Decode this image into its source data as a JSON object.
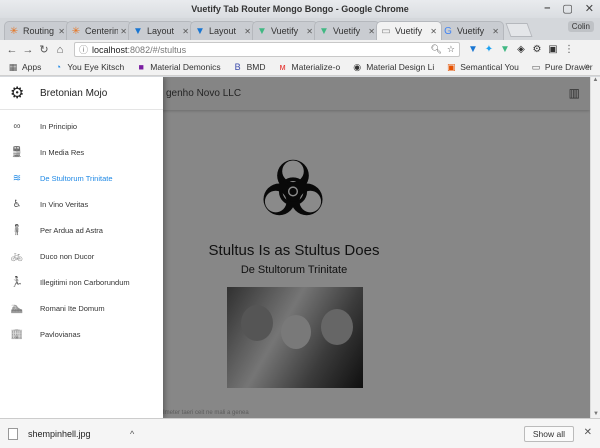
{
  "window": {
    "title": "Vuetify Tab Router Mongo Bongo - Google Chrome",
    "controls": [
      "–",
      "▢",
      "✕"
    ]
  },
  "tabs": [
    {
      "label": "Routing",
      "icon": "asterisk-icon",
      "color": "#e8711a",
      "active": false
    },
    {
      "label": "Centerin",
      "icon": "asterisk-icon",
      "color": "#e8711a",
      "active": false
    },
    {
      "label": "Layout",
      "icon": "vuetify-icon",
      "color": "#1976d2",
      "active": false
    },
    {
      "label": "Layout",
      "icon": "vuetify-icon",
      "color": "#1976d2",
      "active": false
    },
    {
      "label": "Vuetify",
      "icon": "vue-icon",
      "color": "#41b883",
      "active": false
    },
    {
      "label": "Vuetify",
      "icon": "vue-icon",
      "color": "#41b883",
      "active": false
    },
    {
      "label": "Vuetify",
      "icon": "page-icon",
      "color": "#888888",
      "active": true
    },
    {
      "label": "Vuetify",
      "icon": "google-icon",
      "color": "#4285f4",
      "active": false
    }
  ],
  "profile": "Colin",
  "toolbar": {
    "back": "←",
    "forward": "→",
    "reload": "↻",
    "home": "⌂",
    "url_host": "localhost",
    "url_rest": ":8082/#/stultus",
    "info": "ⓘ"
  },
  "bookmarks": [
    {
      "label": "Apps",
      "color": "#555555",
      "glyph": "▦"
    },
    {
      "label": "You Eye Kitsch",
      "color": "#1e88e5",
      "glyph": "◔"
    },
    {
      "label": "Material Demonics",
      "color": "#7b1fa2",
      "glyph": "■"
    },
    {
      "label": "BMD",
      "color": "#3949ab",
      "glyph": "B"
    },
    {
      "label": "Materialize-o",
      "color": "#e53935",
      "glyph": "ᴍ"
    },
    {
      "label": "Material Design Li",
      "color": "#333333",
      "glyph": "◉"
    },
    {
      "label": "Semantical You",
      "color": "#e65100",
      "glyph": "▣"
    },
    {
      "label": "Pure Drawer",
      "color": "#555555",
      "glyph": "▭"
    }
  ],
  "appbar": {
    "title": "genho Novo LLC"
  },
  "drawer": {
    "title": "Bretonian Mojo",
    "items": [
      {
        "label": "In Principio",
        "icon": "infinity-icon",
        "glyph": "∞",
        "active": false
      },
      {
        "label": "In Media Res",
        "icon": "train-icon",
        "glyph": "🚆",
        "active": false
      },
      {
        "label": "De Stultorum Trinitate",
        "icon": "waves-icon",
        "glyph": "≋",
        "active": true
      },
      {
        "label": "In Vino Veritas",
        "icon": "wheelchair-icon",
        "glyph": "♿",
        "active": false
      },
      {
        "label": "Per Ardua ad Astra",
        "icon": "person-icon",
        "glyph": "🧍",
        "active": false
      },
      {
        "label": "Duco non Ducor",
        "icon": "bicycle-icon",
        "glyph": "🚲",
        "active": false
      },
      {
        "label": "Illegitimi non Carborundum",
        "icon": "running-icon",
        "glyph": "🏃",
        "active": false
      },
      {
        "label": "Romani Ite Domum",
        "icon": "swimming-icon",
        "glyph": "🏊",
        "active": false
      },
      {
        "label": "Pavlovianas",
        "icon": "building-icon",
        "glyph": "🏢",
        "active": false
      }
    ]
  },
  "content": {
    "headline": "Stultus Is as Stultus Does",
    "subline": "De Stultorum Trinitate",
    "footer": "Imeter taeri ceit ne mali a genea"
  },
  "download": {
    "filename": "shempinhell.jpg",
    "show_all": "Show all"
  },
  "colors": {
    "accent": "#1e88e5",
    "scrim": "rgba(0,0,0,0.46)"
  }
}
